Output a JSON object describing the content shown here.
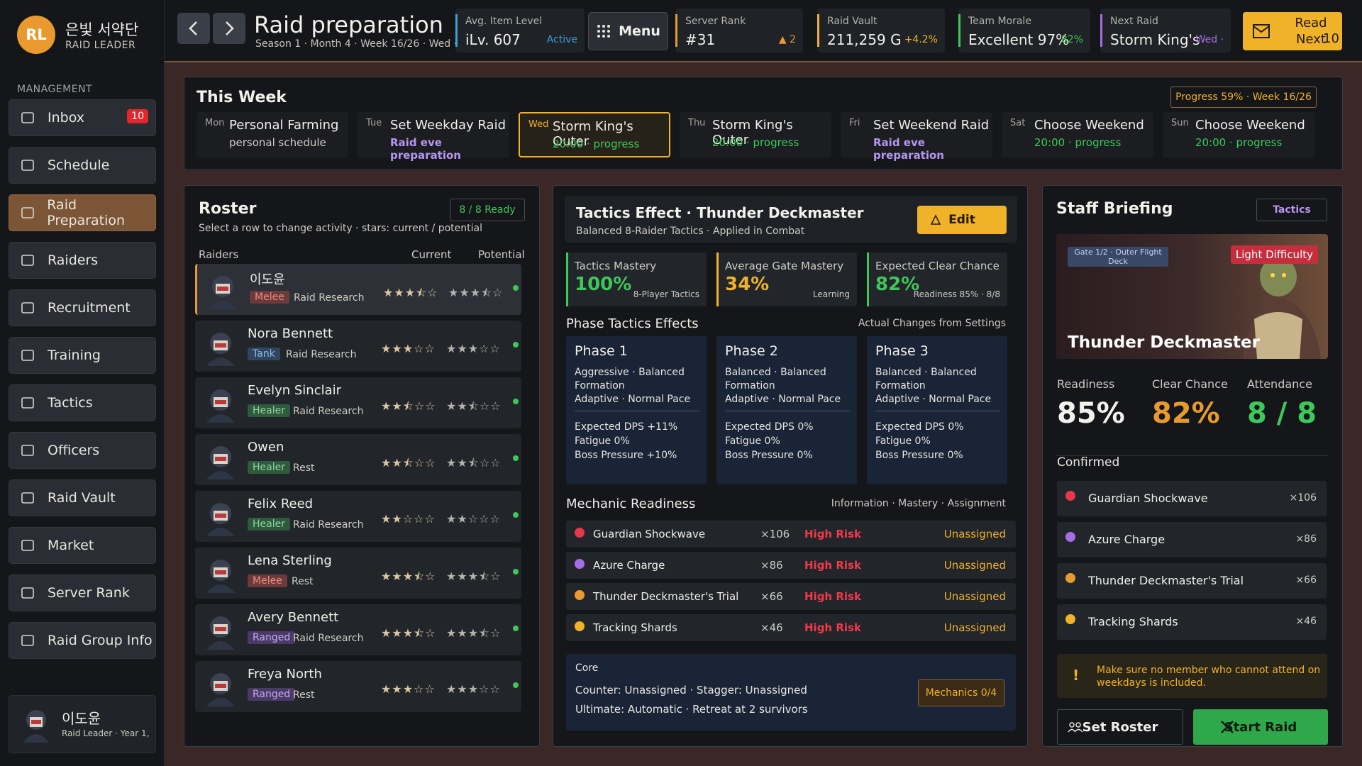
{
  "sidebar": {
    "logo": "RL",
    "guild_name": "은빛 서약단",
    "guild_role": "RAID LEADER",
    "section": "MANAGEMENT",
    "items": [
      {
        "label": "Inbox",
        "icon": "inbox-icon",
        "badge": "10"
      },
      {
        "label": "Schedule",
        "icon": "calendar-icon"
      },
      {
        "label": "Raid Preparation",
        "icon": "crossed-swords-icon",
        "active": true
      },
      {
        "label": "Raiders",
        "icon": "group-icon"
      },
      {
        "label": "Recruitment",
        "icon": "magnifier-icon"
      },
      {
        "label": "Training",
        "icon": "dumbbell-icon"
      },
      {
        "label": "Tactics",
        "icon": "cone-icon"
      },
      {
        "label": "Officers",
        "icon": "shield-icon"
      },
      {
        "label": "Raid Vault",
        "icon": "coins-icon"
      },
      {
        "label": "Market",
        "icon": "shop-icon"
      },
      {
        "label": "Server Rank",
        "icon": "trophy-icon"
      },
      {
        "label": "Raid Group Info",
        "icon": "building-icon"
      }
    ],
    "profile": {
      "name": "이도윤",
      "sub": "Raid Leader · Year 1,"
    }
  },
  "header": {
    "title": "Raid preparation",
    "subtitle": "Season 1 · Month 4 · Week 16/26 · Wed ·",
    "stats": [
      {
        "label": "Avg. Item Level",
        "value": "iLv. 607",
        "extra": "Active",
        "color": "#3aa0d8"
      },
      {
        "label": "Server Rank",
        "value": "#31",
        "extra": "▲ 2",
        "color": "#e89a2f"
      },
      {
        "label": "Raid Vault",
        "value": "211,259 G",
        "extra": "+4.2%",
        "color": "#f0b229"
      },
      {
        "label": "Team Morale",
        "value": "Excellent 97%",
        "extra": "82%",
        "color": "#3ec85a"
      },
      {
        "label": "Next Raid",
        "value": "Storm King's",
        "extra": "Wed ·",
        "color": "#a56ee6"
      }
    ],
    "menu_label": "Menu",
    "read_label": "Read\nNext",
    "read_count": "10"
  },
  "week": {
    "title": "This Week",
    "progress": "Progress 59% · Week 16/26",
    "days": [
      {
        "d": "Mon",
        "t": "Personal Farming",
        "s": "personal schedule",
        "sc": "#cfccc5"
      },
      {
        "d": "Tue",
        "t": "Set Weekday Raid",
        "s": "Raid eve preparation",
        "sc": "#b795f0"
      },
      {
        "d": "Wed",
        "t": "Storm King's Outer",
        "s": "20:00 · progress",
        "sc": "#3ec85a"
      },
      {
        "d": "Thu",
        "t": "Storm King's Outer",
        "s": "20:00 · progress",
        "sc": "#3ec85a"
      },
      {
        "d": "Fri",
        "t": "Set Weekend Raid",
        "s": "Raid eve preparation",
        "sc": "#b795f0"
      },
      {
        "d": "Sat",
        "t": "Choose Weekend",
        "s": "20:00 · progress",
        "sc": "#3ec85a"
      },
      {
        "d": "Sun",
        "t": "Choose Weekend",
        "s": "20:00 · progress",
        "sc": "#3ec85a"
      }
    ]
  },
  "roster": {
    "title": "Roster",
    "ready": "8 / 8 Ready",
    "hint": "Select a row to change activity · stars: current / potential",
    "col_raiders": "Raiders",
    "col_current": "Current",
    "col_potential": "Potential",
    "rows": [
      {
        "name": "이도윤",
        "role": "Melee",
        "activity": "Raid Research",
        "current": "★★★⯪☆",
        "potential": "★★★⯪☆"
      },
      {
        "name": "Nora Bennett",
        "role": "Tank",
        "activity": "Raid Research",
        "current": "★★★☆☆",
        "potential": "★★★☆☆"
      },
      {
        "name": "Evelyn Sinclair",
        "role": "Healer",
        "activity": "Raid Research",
        "current": "★★⯪☆☆",
        "potential": "★★⯪☆☆"
      },
      {
        "name": "Owen",
        "role": "Healer",
        "activity": "Rest",
        "current": "★★⯪☆☆",
        "potential": "★★⯪☆☆"
      },
      {
        "name": "Felix Reed",
        "role": "Healer",
        "activity": "Raid Research",
        "current": "★★☆☆☆",
        "potential": "★★☆☆☆"
      },
      {
        "name": "Lena Sterling",
        "role": "Melee",
        "activity": "Rest",
        "current": "★★★⯪☆",
        "potential": "★★★⯪☆"
      },
      {
        "name": "Avery Bennett",
        "role": "Ranged",
        "activity": "Raid Research",
        "current": "★★★⯪☆",
        "potential": "★★★⯪☆"
      },
      {
        "name": "Freya North",
        "role": "Ranged",
        "activity": "Rest",
        "current": "★★★☆☆",
        "potential": "★★★☆☆"
      }
    ]
  },
  "tactics": {
    "title": "Tactics Effect · Thunder Deckmaster",
    "subtitle": "Balanced 8-Raider Tactics · Applied in Combat",
    "edit_label": "Edit",
    "metrics": [
      {
        "label": "Tactics Mastery",
        "value": "100%",
        "sub": "8-Player Tactics",
        "color": "#3ec85a"
      },
      {
        "label": "Average Gate Mastery",
        "value": "34%",
        "sub": "Learning",
        "color": "#f0b229"
      },
      {
        "label": "Expected Clear Chance",
        "value": "82%",
        "sub": "Readiness 85% · 8/8",
        "color": "#3ec85a"
      }
    ],
    "phase_title": "Phase Tactics Effects",
    "phase_note": "Actual Changes from Settings",
    "phases": [
      {
        "title": "Phase 1",
        "desc": "Aggressive · Balanced Formation\nAdaptive · Normal Pace",
        "effects": "Expected DPS +11%\nFatigue 0%\nBoss Pressure +10%"
      },
      {
        "title": "Phase 2",
        "desc": "Balanced · Balanced Formation\nAdaptive · Normal Pace",
        "effects": "Expected DPS 0%\nFatigue 0%\nBoss Pressure 0%"
      },
      {
        "title": "Phase 3",
        "desc": "Balanced · Balanced Formation\nAdaptive · Normal Pace",
        "effects": "Expected DPS 0%\nFatigue 0%\nBoss Pressure 0%"
      }
    ],
    "mech_title": "Mechanic Readiness",
    "mech_note": "Information · Mastery · Assignment",
    "mechanics": [
      {
        "name": "Guardian Shockwave",
        "count": "×106",
        "risk": "High Risk",
        "assign": "Unassigned",
        "color": "#e8364a"
      },
      {
        "name": "Azure Charge",
        "count": "×86",
        "risk": "High Risk",
        "assign": "Unassigned",
        "color": "#a56ee6"
      },
      {
        "name": "Thunder Deckmaster's Trial",
        "count": "×66",
        "risk": "High Risk",
        "assign": "Unassigned",
        "color": "#e89a2f"
      },
      {
        "name": "Tracking Shards",
        "count": "×46",
        "risk": "High Risk",
        "assign": "Unassigned",
        "color": "#f0b229"
      }
    ],
    "core": {
      "title": "Core",
      "line1": "Counter: Unassigned · Stagger: Unassigned",
      "line2": "Ultimate: Automatic · Retreat at 2 survivors",
      "button": "Mechanics 0/4"
    }
  },
  "briefing": {
    "title": "Staff Briefing",
    "tab": "Tactics",
    "gate": "Gate 1/2 · Outer Flight Deck",
    "difficulty": "Light Difficulty",
    "boss": "Thunder Deckmaster",
    "stats": [
      {
        "label": "Readiness",
        "value": "85%",
        "color": "#f3f1eb"
      },
      {
        "label": "Clear Chance",
        "value": "82%",
        "color": "#e89a2f"
      },
      {
        "label": "Attendance",
        "value": "8 / 8",
        "color": "#3ec85a"
      }
    ],
    "confirmed": "Confirmed",
    "items": [
      {
        "name": "Guardian Shockwave",
        "count": "×106",
        "color": "#e8364a"
      },
      {
        "name": "Azure Charge",
        "count": "×86",
        "color": "#a56ee6"
      },
      {
        "name": "Thunder Deckmaster's Trial",
        "count": "×66",
        "color": "#e89a2f"
      },
      {
        "name": "Tracking Shards",
        "count": "×46",
        "color": "#f0b229"
      }
    ],
    "warning": "Make sure no member who cannot attend on weekdays is included.",
    "set_roster": "Set Roster",
    "start_raid": "Start Raid"
  }
}
